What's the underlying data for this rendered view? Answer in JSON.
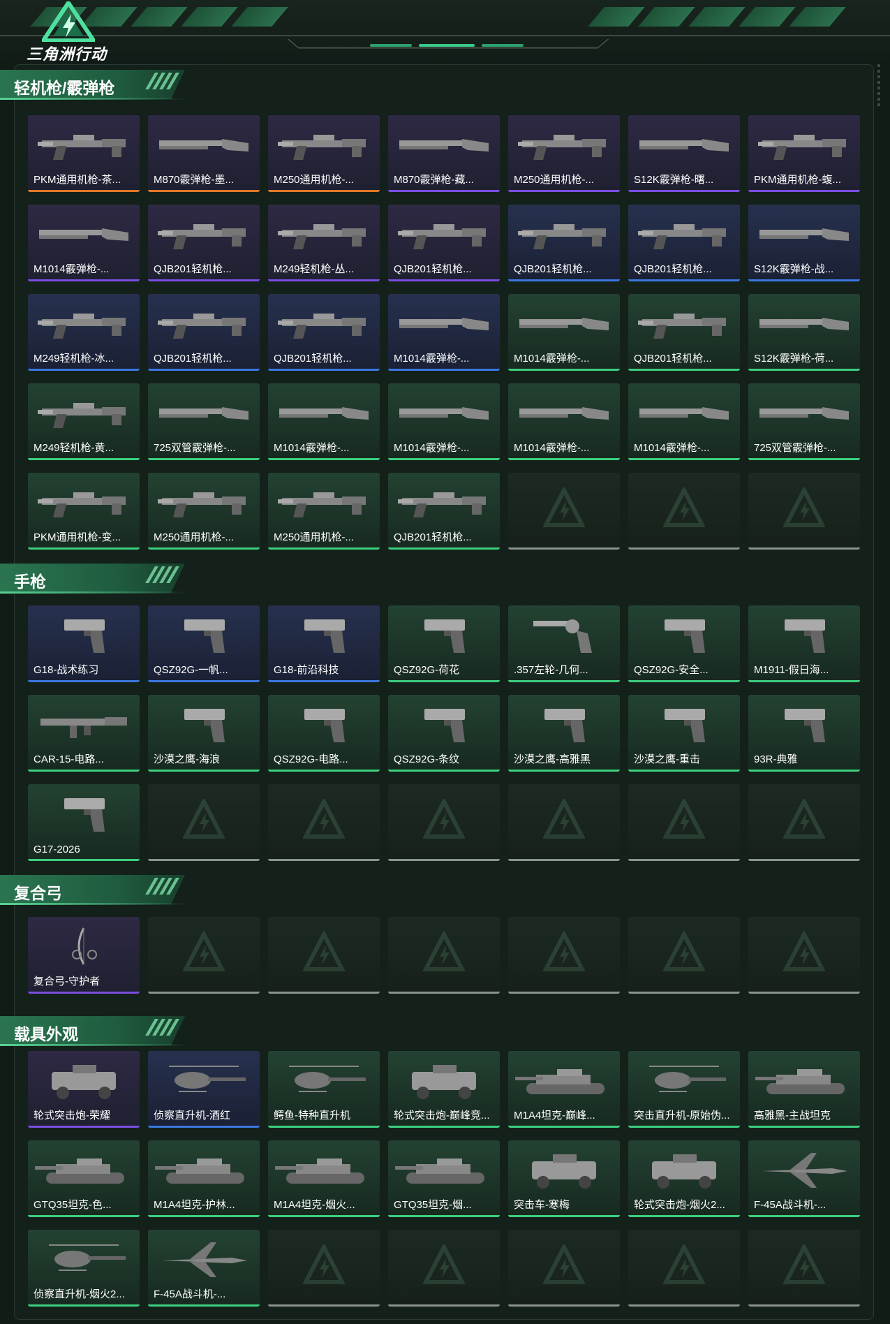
{
  "header": {
    "logo_text": "三角洲行动"
  },
  "colors": {
    "orange": "#e0782a",
    "purple": "#7a4ee0",
    "blue": "#3a78e0",
    "green": "#3ccf7f",
    "gray": "#8a938e"
  },
  "sections": [
    {
      "title": "轻机枪/霰弹枪",
      "items": [
        {
          "label": "PKM通用机枪-茶...",
          "tier": "orange",
          "bg": "purple",
          "icon": "machine-gun-icon"
        },
        {
          "label": "M870霰弹枪-墨...",
          "tier": "orange",
          "bg": "purple",
          "icon": "shotgun-icon"
        },
        {
          "label": "M250通用机枪-...",
          "tier": "orange",
          "bg": "purple",
          "icon": "machine-gun-icon"
        },
        {
          "label": "M870霰弹枪-藏...",
          "tier": "purple",
          "bg": "purple",
          "icon": "shotgun-icon"
        },
        {
          "label": "M250通用机枪-...",
          "tier": "purple",
          "bg": "purple",
          "icon": "machine-gun-icon"
        },
        {
          "label": "S12K霰弹枪-曙...",
          "tier": "purple",
          "bg": "purple",
          "icon": "shotgun-icon"
        },
        {
          "label": "PKM通用机枪-蝮...",
          "tier": "purple",
          "bg": "purple",
          "icon": "machine-gun-icon"
        },
        {
          "label": "M1014霰弹枪-...",
          "tier": "purple",
          "bg": "purple",
          "icon": "shotgun-icon"
        },
        {
          "label": "QJB201轻机枪...",
          "tier": "purple",
          "bg": "purple",
          "icon": "machine-gun-icon"
        },
        {
          "label": "M249轻机枪-丛...",
          "tier": "purple",
          "bg": "purple",
          "icon": "machine-gun-icon"
        },
        {
          "label": "QJB201轻机枪...",
          "tier": "purple",
          "bg": "purple",
          "icon": "machine-gun-icon"
        },
        {
          "label": "QJB201轻机枪...",
          "tier": "blue",
          "bg": "blue",
          "icon": "machine-gun-icon"
        },
        {
          "label": "QJB201轻机枪...",
          "tier": "blue",
          "bg": "blue",
          "icon": "machine-gun-icon"
        },
        {
          "label": "S12K霰弹枪-战...",
          "tier": "blue",
          "bg": "blue",
          "icon": "shotgun-icon"
        },
        {
          "label": "M249轻机枪-冰...",
          "tier": "blue",
          "bg": "blue",
          "icon": "machine-gun-icon"
        },
        {
          "label": "QJB201轻机枪...",
          "tier": "blue",
          "bg": "blue",
          "icon": "machine-gun-icon"
        },
        {
          "label": "QJB201轻机枪...",
          "tier": "blue",
          "bg": "blue",
          "icon": "machine-gun-icon"
        },
        {
          "label": "M1014霰弹枪-...",
          "tier": "blue",
          "bg": "blue",
          "icon": "shotgun-icon"
        },
        {
          "label": "M1014霰弹枪-...",
          "tier": "green",
          "bg": "green",
          "icon": "shotgun-icon"
        },
        {
          "label": "QJB201轻机枪...",
          "tier": "green",
          "bg": "green",
          "icon": "machine-gun-icon"
        },
        {
          "label": "S12K霰弹枪-荷...",
          "tier": "green",
          "bg": "green",
          "icon": "shotgun-icon"
        },
        {
          "label": "M249轻机枪-黄...",
          "tier": "green",
          "bg": "green",
          "icon": "machine-gun-icon"
        },
        {
          "label": "725双管霰弹枪-...",
          "tier": "green",
          "bg": "green",
          "icon": "shotgun-icon"
        },
        {
          "label": "M1014霰弹枪-...",
          "tier": "green",
          "bg": "green",
          "icon": "shotgun-icon"
        },
        {
          "label": "M1014霰弹枪-...",
          "tier": "green",
          "bg": "green",
          "icon": "shotgun-icon"
        },
        {
          "label": "M1014霰弹枪-...",
          "tier": "green",
          "bg": "green",
          "icon": "shotgun-icon"
        },
        {
          "label": "M1014霰弹枪-...",
          "tier": "green",
          "bg": "green",
          "icon": "shotgun-icon"
        },
        {
          "label": "725双管霰弹枪-...",
          "tier": "green",
          "bg": "green",
          "icon": "shotgun-icon"
        },
        {
          "label": "PKM通用机枪-变...",
          "tier": "green",
          "bg": "green",
          "icon": "machine-gun-icon"
        },
        {
          "label": "M250通用机枪-...",
          "tier": "green",
          "bg": "green",
          "icon": "machine-gun-icon"
        },
        {
          "label": "M250通用机枪-...",
          "tier": "green",
          "bg": "green",
          "icon": "machine-gun-icon"
        },
        {
          "label": "QJB201轻机枪...",
          "tier": "green",
          "bg": "green",
          "icon": "machine-gun-icon"
        }
      ],
      "empty_slots": 3
    },
    {
      "title": "手枪",
      "items": [
        {
          "label": "G18-战术练习",
          "tier": "blue",
          "bg": "blue",
          "icon": "pistol-icon"
        },
        {
          "label": "QSZ92G-一帆...",
          "tier": "blue",
          "bg": "blue",
          "icon": "pistol-icon"
        },
        {
          "label": "G18-前沿科技",
          "tier": "blue",
          "bg": "blue",
          "icon": "pistol-icon"
        },
        {
          "label": "QSZ92G-荷花",
          "tier": "green",
          "bg": "green",
          "icon": "pistol-icon"
        },
        {
          "label": ".357左轮-几何...",
          "tier": "green",
          "bg": "green",
          "icon": "revolver-icon"
        },
        {
          "label": "QSZ92G-安全...",
          "tier": "green",
          "bg": "green",
          "icon": "pistol-icon"
        },
        {
          "label": "M1911-假日海...",
          "tier": "green",
          "bg": "green",
          "icon": "pistol-icon"
        },
        {
          "label": "CAR-15-电路...",
          "tier": "green",
          "bg": "green",
          "icon": "rifle-icon"
        },
        {
          "label": "沙漠之鹰-海浪",
          "tier": "green",
          "bg": "green",
          "icon": "pistol-icon"
        },
        {
          "label": "QSZ92G-电路...",
          "tier": "green",
          "bg": "green",
          "icon": "pistol-icon"
        },
        {
          "label": "QSZ92G-条纹",
          "tier": "green",
          "bg": "green",
          "icon": "pistol-icon"
        },
        {
          "label": "沙漠之鹰-高雅黑",
          "tier": "green",
          "bg": "green",
          "icon": "pistol-icon"
        },
        {
          "label": "沙漠之鹰-重击",
          "tier": "green",
          "bg": "green",
          "icon": "pistol-icon"
        },
        {
          "label": "93R-典雅",
          "tier": "green",
          "bg": "green",
          "icon": "pistol-icon"
        },
        {
          "label": "G17-2026",
          "tier": "green",
          "bg": "green",
          "icon": "pistol-icon"
        }
      ],
      "empty_slots": 6
    },
    {
      "title": "复合弓",
      "items": [
        {
          "label": "复合弓-守护者",
          "tier": "purple",
          "bg": "purple",
          "icon": "bow-icon"
        }
      ],
      "empty_slots": 6
    },
    {
      "title": "载具外观",
      "items": [
        {
          "label": "轮式突击炮-荣耀",
          "tier": "purple",
          "bg": "purple",
          "icon": "armored-car-icon"
        },
        {
          "label": "侦察直升机-酒红",
          "tier": "blue",
          "bg": "blue",
          "icon": "helicopter-icon"
        },
        {
          "label": "鳄鱼-特种直升机",
          "tier": "green",
          "bg": "green",
          "icon": "helicopter-icon"
        },
        {
          "label": "轮式突击炮-巅峰竞...",
          "tier": "green",
          "bg": "green",
          "icon": "armored-car-icon"
        },
        {
          "label": "M1A4坦克-巅峰...",
          "tier": "green",
          "bg": "green",
          "icon": "tank-icon"
        },
        {
          "label": "突击直升机-原始伪...",
          "tier": "green",
          "bg": "green",
          "icon": "helicopter-icon"
        },
        {
          "label": "高雅黑-主战坦克",
          "tier": "green",
          "bg": "green",
          "icon": "tank-icon"
        },
        {
          "label": "GTQ35坦克-色...",
          "tier": "green",
          "bg": "green",
          "icon": "tank-icon"
        },
        {
          "label": "M1A4坦克-护林...",
          "tier": "green",
          "bg": "green",
          "icon": "tank-icon"
        },
        {
          "label": "M1A4坦克-烟火...",
          "tier": "green",
          "bg": "green",
          "icon": "tank-icon"
        },
        {
          "label": "GTQ35坦克-烟...",
          "tier": "green",
          "bg": "green",
          "icon": "tank-icon"
        },
        {
          "label": "突击车-寒梅",
          "tier": "green",
          "bg": "green",
          "icon": "armored-car-icon"
        },
        {
          "label": "轮式突击炮-烟火2...",
          "tier": "green",
          "bg": "green",
          "icon": "armored-car-icon"
        },
        {
          "label": "F-45A战斗机-...",
          "tier": "green",
          "bg": "green",
          "icon": "jet-icon"
        },
        {
          "label": "侦察直升机-烟火2...",
          "tier": "green",
          "bg": "green",
          "icon": "helicopter-icon"
        },
        {
          "label": "F-45A战斗机-...",
          "tier": "green",
          "bg": "green",
          "icon": "jet-icon"
        }
      ],
      "empty_slots": 5
    }
  ]
}
